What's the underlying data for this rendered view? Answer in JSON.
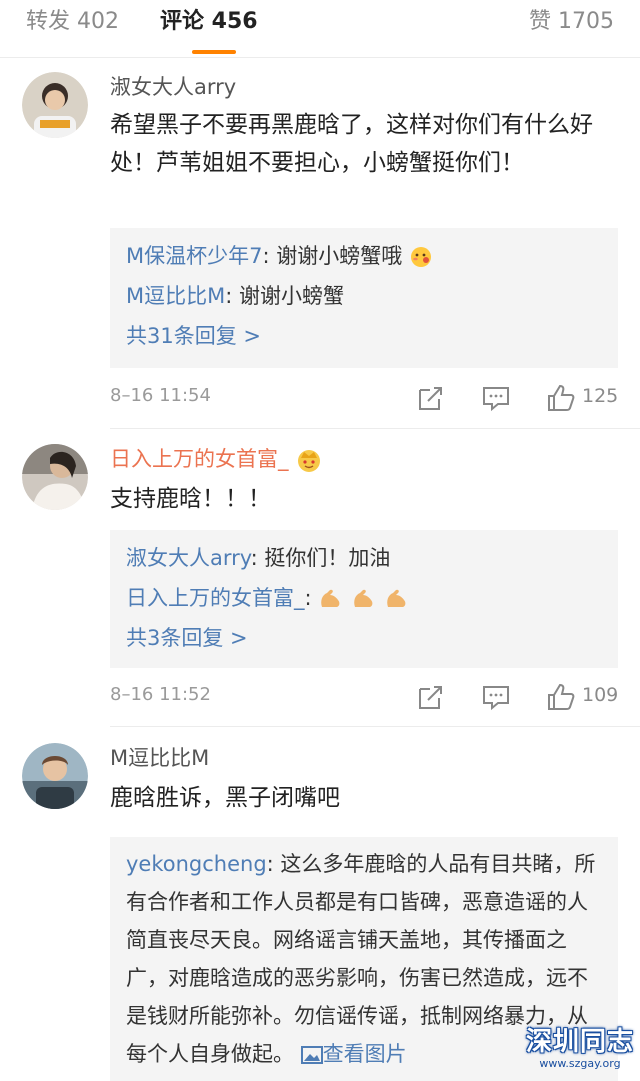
{
  "tabs": {
    "repost_label": "转发 402",
    "comments_label": "评论 456",
    "likes_label": "赞 1705"
  },
  "comments": [
    {
      "username": "淑女大人arry",
      "text": "希望黑子不要再黑鹿晗了，这样对你们有什么好处！芦苇姐姐不要担心，小螃蟹挺你们！",
      "replies": [
        {
          "name": "M保温杯少年7",
          "text": ": 谢谢小螃蟹哦"
        },
        {
          "name": "M逗比比M",
          "text": ": 谢谢小螃蟹"
        }
      ],
      "more_label": "共31条回复 >",
      "time": "8–16 11:54",
      "like_count": "125"
    },
    {
      "username": "日入上万的女首富_",
      "text": "支持鹿晗！！！",
      "replies": [
        {
          "name": "淑女大人arry",
          "text": ": 挺你们！加油"
        },
        {
          "name": "日入上万的女首富_",
          "text": ": "
        }
      ],
      "more_label": "共3条回复 >",
      "time": "8–16 11:52",
      "like_count": "109"
    },
    {
      "username": "M逗比比M",
      "text": "鹿晗胜诉，黑子闭嘴吧",
      "replies": [
        {
          "name": "yekongcheng",
          "text": ": 这么多年鹿晗的人品有目共睹，所有合作者和工作人员都是有口皆碑，恶意造谣的人简直丧尽天良。网络谣言铺天盖地，其传播面之广，对鹿晗造成的恶劣影响，伤害已然造成，远不是钱财所能弥补。勿信谣传谣，抵制网络暴力，从每个人自身做起。",
          "link": "查看图片"
        }
      ]
    }
  ],
  "watermark": {
    "title": "深圳同志",
    "url": "www.szgay.org"
  },
  "colors": {
    "accent": "#ff8200",
    "link": "#4f7db5",
    "vip_name": "#eb7350",
    "reply_bg": "#f4f4f4"
  },
  "icons": [
    "share-icon",
    "comment-icon",
    "like-icon",
    "crown-icon",
    "muscle-icon",
    "blush-emoji-icon",
    "image-icon"
  ]
}
